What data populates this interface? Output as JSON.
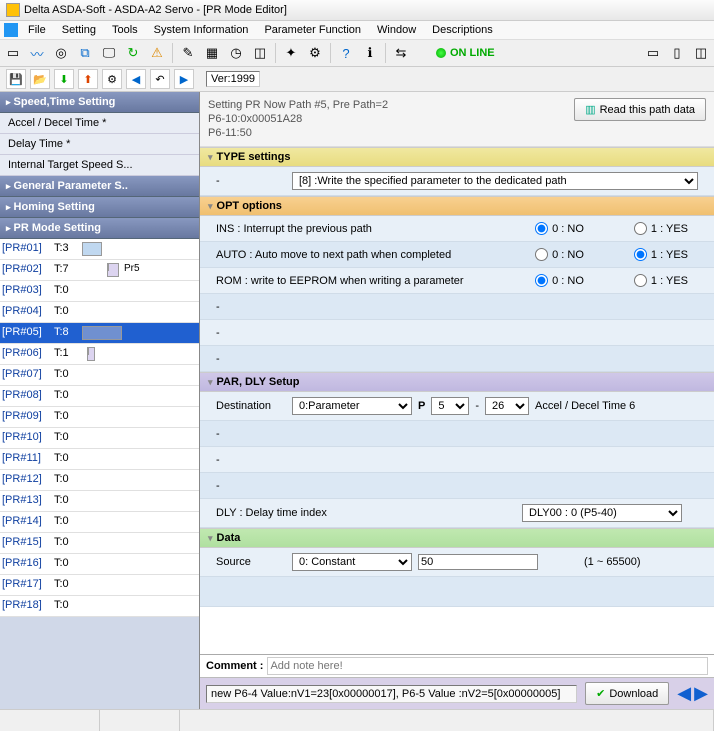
{
  "title": "Delta ASDA-Soft - ASDA-A2 Servo - [PR Mode Editor]",
  "menu": [
    "File",
    "Setting",
    "Tools",
    "System Information",
    "Parameter Function",
    "Window",
    "Descriptions"
  ],
  "online": "ON LINE",
  "version_label": "Ver:",
  "version": "1999",
  "sidebar": {
    "groups": [
      {
        "title": "Speed,Time Setting",
        "items": [
          "Accel / Decel Time  *",
          "Delay Time  *",
          "Internal Target Speed S..."
        ]
      },
      {
        "title": "General Parameter S..",
        "items": []
      },
      {
        "title": "Homing Setting",
        "items": []
      },
      {
        "title": "PR Mode Setting",
        "items": []
      }
    ],
    "pr": [
      {
        "id": "[PR#01]",
        "t": "T:3",
        "segs": [
          {
            "l": 0,
            "w": 20,
            "c": "#c0d8f0"
          }
        ]
      },
      {
        "id": "[PR#02]",
        "t": "T:7",
        "note": "Pr5",
        "segs": [
          {
            "l": 25,
            "w": 12,
            "c": "#dcd4f0"
          },
          {
            "l": 25,
            "w": 2,
            "c": "#68a",
            "h": true
          }
        ]
      },
      {
        "id": "[PR#03]",
        "t": "T:0"
      },
      {
        "id": "[PR#04]",
        "t": "T:0"
      },
      {
        "id": "[PR#05]",
        "t": "T:8",
        "sel": true,
        "segs": [
          {
            "l": 0,
            "w": 40,
            "c": "#7090d0"
          }
        ]
      },
      {
        "id": "[PR#06]",
        "t": "T:1",
        "segs": [
          {
            "l": 5,
            "w": 8,
            "c": "#dcd4f0"
          },
          {
            "l": 5,
            "w": 2,
            "c": "#68a",
            "h": true
          }
        ]
      },
      {
        "id": "[PR#07]",
        "t": "T:0"
      },
      {
        "id": "[PR#08]",
        "t": "T:0"
      },
      {
        "id": "[PR#09]",
        "t": "T:0"
      },
      {
        "id": "[PR#10]",
        "t": "T:0"
      },
      {
        "id": "[PR#11]",
        "t": "T:0"
      },
      {
        "id": "[PR#12]",
        "t": "T:0"
      },
      {
        "id": "[PR#13]",
        "t": "T:0"
      },
      {
        "id": "[PR#14]",
        "t": "T:0"
      },
      {
        "id": "[PR#15]",
        "t": "T:0"
      },
      {
        "id": "[PR#16]",
        "t": "T:0"
      },
      {
        "id": "[PR#17]",
        "t": "T:0"
      },
      {
        "id": "[PR#18]",
        "t": "T:0"
      }
    ]
  },
  "path_info": {
    "l1": "Setting PR Now Path #5, Pre Path=2",
    "l2": "P6-10:0x00051A28",
    "l3": "P6-11:50",
    "read_btn": "Read this path data"
  },
  "type": {
    "head": "TYPE settings",
    "dash": "-",
    "sel": "[8] :Write the specified parameter to the dedicated path"
  },
  "opt": {
    "head": "OPT options",
    "rows": [
      {
        "label": "INS : Interrupt the previous path",
        "val": 0
      },
      {
        "label": "AUTO : Auto move to next path when completed",
        "val": 1
      },
      {
        "label": "ROM : write to EEPROM when writing a parameter",
        "val": 0
      }
    ],
    "no": "0 : NO",
    "yes": "1 : YES",
    "dash": "-"
  },
  "par": {
    "head": "PAR, DLY Setup",
    "dest": "Destination",
    "dest_sel": "0:Parameter",
    "p": "P",
    "p1": "5",
    "p2": "26",
    "p_text": "Accel / Decel Time 6",
    "dash": "-",
    "dly_lbl": "DLY : Delay time index",
    "dly_sel": "DLY00 : 0 (P5-40)"
  },
  "data": {
    "head": "Data",
    "src": "Source",
    "src_sel": "0: Constant",
    "val": "50",
    "range": "(1 ~ 65500)"
  },
  "comment": {
    "lbl": "Comment :",
    "ph": "Add note here!"
  },
  "download": {
    "result": "new P6-4 Value:nV1=23[0x00000017], P6-5 Value :nV2=5[0x00000005]",
    "btn": "Download"
  }
}
